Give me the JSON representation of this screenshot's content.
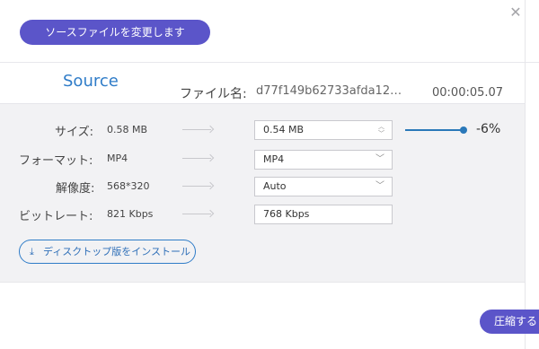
{
  "header": {
    "change_source_label": "ソースファイルを変更します",
    "close_glyph": "✕"
  },
  "source": {
    "title": "Source",
    "filename_label": "ファイル名:",
    "filename_value": "d77f149b62733afda12…",
    "duration": "00:00:05.07"
  },
  "rows": {
    "size": {
      "label": "サイズ:",
      "source": "0.58 MB",
      "target": "0.54 MB"
    },
    "format": {
      "label": "フォーマット:",
      "source": "MP4",
      "target": "MP4"
    },
    "resolution": {
      "label": "解像度:",
      "source": "568*320",
      "target": "Auto"
    },
    "bitrate": {
      "label": "ビットレート:",
      "source": "821 Kbps",
      "target": "768 Kbps"
    }
  },
  "compression": {
    "percent_label": "-6%",
    "slider_level_fraction": 1.0
  },
  "install": {
    "label": "ディスクトップ版をインストール",
    "icon": "download-icon"
  },
  "footer": {
    "compress_label": "圧縮する"
  },
  "colors": {
    "accent": "#5b55c9",
    "link": "#2f7cc8",
    "panel_bg": "#f2f2f4"
  }
}
